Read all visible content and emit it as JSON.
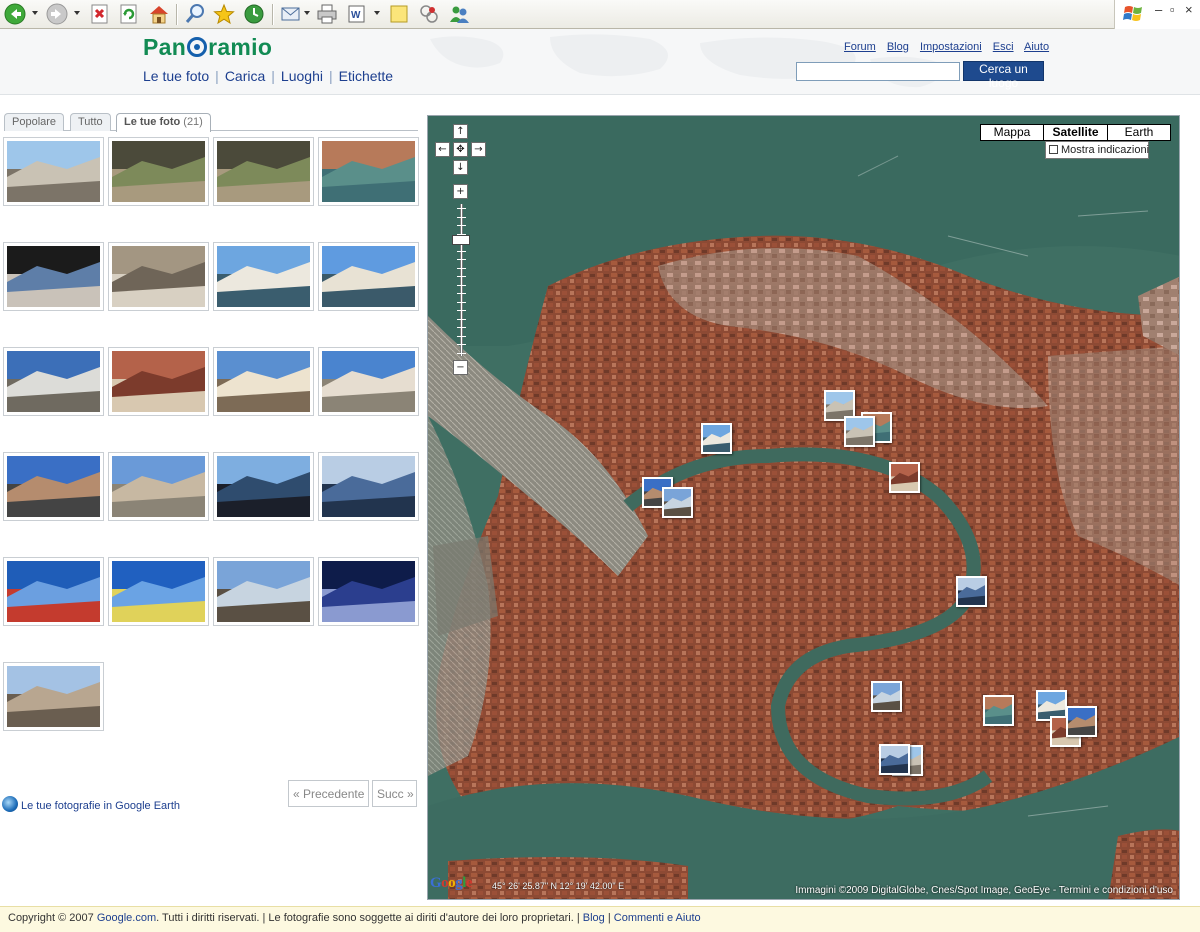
{
  "browser": {
    "toolbar_icons": [
      "back-icon",
      "forward-icon",
      "stop-icon",
      "refresh-icon",
      "home-icon",
      "search-icon",
      "favorites-icon",
      "history-icon",
      "mail-icon",
      "print-icon",
      "edit-icon",
      "messenger-icon",
      "research-icon",
      "contacts-icon"
    ],
    "window_controls": {
      "minimize": "–",
      "restore": "▫",
      "close": "×"
    }
  },
  "header": {
    "logo": "Panoramio",
    "nav": [
      "Le tue foto",
      "Carica",
      "Luoghi",
      "Etichette"
    ],
    "top_links": [
      "Forum",
      "Blog",
      "Impostazioni",
      "Esci",
      "Aiuto"
    ],
    "search_value": "",
    "search_button": "Cerca un luogo"
  },
  "tabs": [
    {
      "label": "Popolare",
      "count": ""
    },
    {
      "label": "Tutto",
      "count": ""
    },
    {
      "label": "Le tue foto",
      "count": "(21)"
    }
  ],
  "active_tab": "Le tue foto",
  "photos": [
    "station-building",
    "canal-path",
    "canal-path-2",
    "canal-boats",
    "doorway-figure",
    "narrow-alley",
    "rialto-bridge",
    "rialto-bridge-2",
    "waterfront-gondolas",
    "brick-street",
    "church-square",
    "bridge-statue",
    "san-marco-campanile",
    "piazza-lamp",
    "gondolas-row",
    "gondola-poles",
    "blue-tunnel-people",
    "blue-tunnel",
    "station-modern",
    "night-station",
    "well-head"
  ],
  "pager": {
    "prev": "« Precedente",
    "next": "Succ »"
  },
  "google_earth_link": "Le tue fotografie in Google Earth",
  "map": {
    "types": [
      "Mappa",
      "Satellite",
      "Earth"
    ],
    "active_type": "Satellite",
    "labels_checkbox": "Mostra indicazioni",
    "labels_checked": false,
    "coordinates": "45° 26' 25.87\" N 12° 19' 42.00\" E",
    "attribution": "Immagini ©2009 DigitalGlobe, Cnes/Spot Image, GeoEye - Termini e condizioni d'uso",
    "provider_logo": "Google",
    "zoom_level": 0.22,
    "pan_controls": {
      "up": "↑",
      "left": "←",
      "center": "✥",
      "right": "→",
      "down": "↓",
      "zoom_in": "+",
      "zoom_out": "−"
    },
    "markers_count": 15
  },
  "footer": {
    "copyright_prefix": "Copyright © 2007 ",
    "copyright_link": "Google.com",
    "copyright_text": ". Tutti i diritti riservati. | Le fotografie sono soggette ai diriti d'autore dei loro proprietari. | ",
    "blog": "Blog",
    "sep": " | ",
    "help": "Commenti e Aiuto"
  },
  "colors": {
    "brand_green": "#128b54",
    "link_blue": "#1d3f8f",
    "search_button": "#1e4a8e",
    "lagoon": "#3d6e62",
    "rooftops": "#8a4a35"
  }
}
